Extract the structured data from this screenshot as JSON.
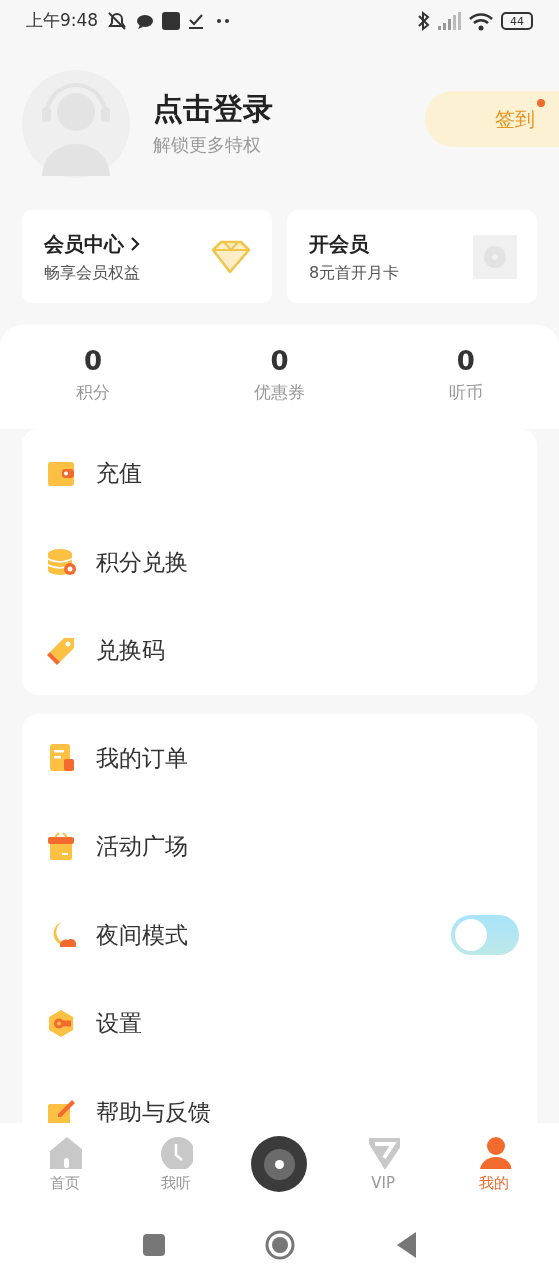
{
  "status_bar": {
    "time": "上午9:48",
    "battery": "44"
  },
  "profile": {
    "title": "点击登录",
    "subtitle": "解锁更多特权",
    "checkin": {
      "label": "签到",
      "badge": true
    }
  },
  "member_cards": [
    {
      "kind": "center",
      "title": "会员中心",
      "subtitle": "畅享会员权益"
    },
    {
      "kind": "open",
      "title": "开会员",
      "subtitle": "8元首开月卡"
    }
  ],
  "stats": [
    {
      "value": "0",
      "label": "积分"
    },
    {
      "value": "0",
      "label": "优惠券"
    },
    {
      "value": "0",
      "label": "听币"
    }
  ],
  "menu_groups": [
    [
      {
        "kind": "link",
        "label": "充值"
      },
      {
        "kind": "link",
        "label": "积分兑换"
      },
      {
        "kind": "link",
        "label": "兑换码"
      }
    ],
    [
      {
        "kind": "link",
        "label": "我的订单"
      },
      {
        "kind": "link",
        "label": "活动广场"
      },
      {
        "kind": "toggle",
        "label": "夜间模式",
        "on": false
      },
      {
        "kind": "link",
        "label": "设置"
      },
      {
        "kind": "link",
        "label": "帮助与反馈"
      }
    ]
  ],
  "tab_bar": [
    {
      "kind": "home",
      "label": "首页",
      "selected": false
    },
    {
      "kind": "history",
      "label": "我听",
      "selected": false
    },
    {
      "kind": "player",
      "selected": false
    },
    {
      "kind": "vip",
      "label": "VIP",
      "selected": false
    },
    {
      "kind": "me",
      "label": "我的",
      "selected": true
    }
  ]
}
